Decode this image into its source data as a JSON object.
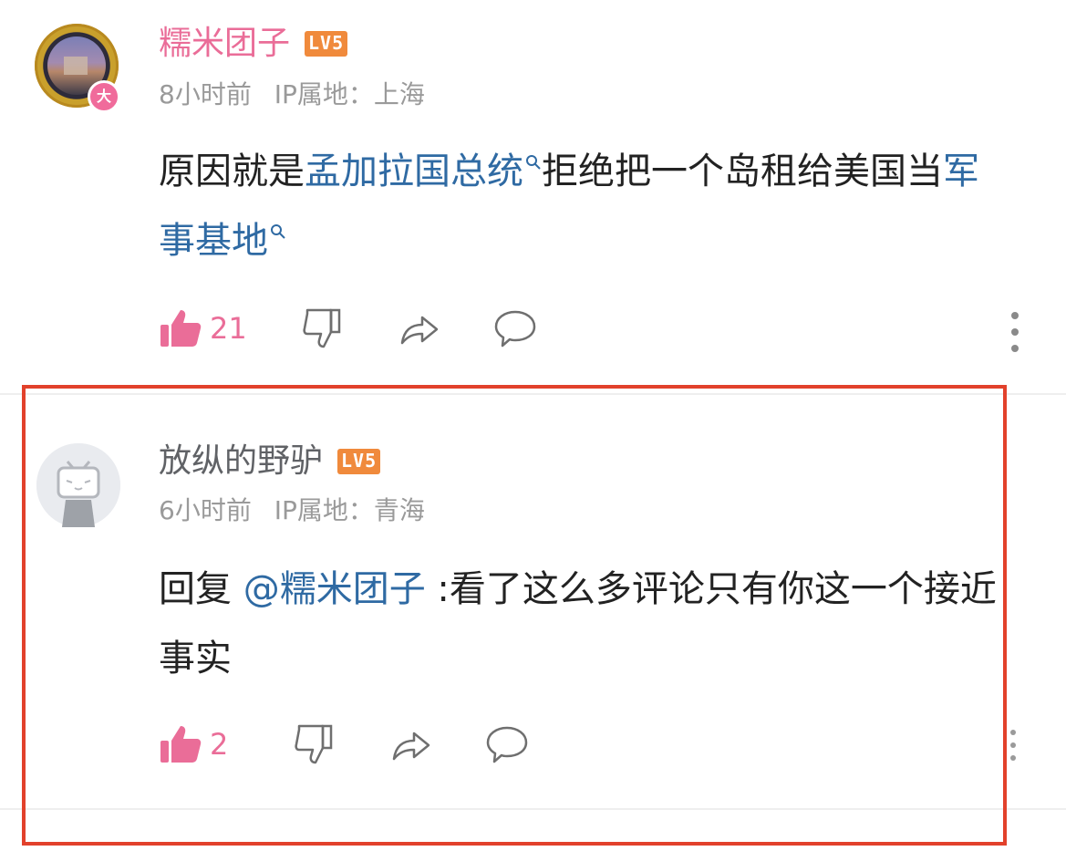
{
  "comments": [
    {
      "username": "糯米团子",
      "level": "LV5",
      "badge": "大",
      "time": "8小时前",
      "ip_label": "IP属地：上海",
      "text_parts": [
        {
          "text": "原因就是",
          "link": false
        },
        {
          "text": "孟加拉国总统",
          "link": true
        },
        {
          "text": "拒绝把一个岛租给美国当",
          "link": false
        },
        {
          "text": "军事基地",
          "link": true
        }
      ],
      "likes": "21",
      "icons": [
        "thumbs-up-icon",
        "thumbs-down-icon",
        "share-icon",
        "reply-icon",
        "more-icon"
      ]
    },
    {
      "username": "放纵的野驴",
      "level": "LV5",
      "time": "6小时前",
      "ip_label": "IP属地：青海",
      "reply_prefix": "回复 ",
      "reply_to": "@糯米团子",
      "text": " :看了这么多评论只有你这一个接近事实",
      "likes": "2",
      "icons": [
        "thumbs-up-icon",
        "thumbs-down-icon",
        "share-icon",
        "reply-icon"
      ]
    }
  ],
  "colors": {
    "accent_pink": "#ea6d98",
    "link_blue": "#2f6aa3",
    "level_badge": "#f08a3c",
    "highlight_box": "#e2412b"
  }
}
